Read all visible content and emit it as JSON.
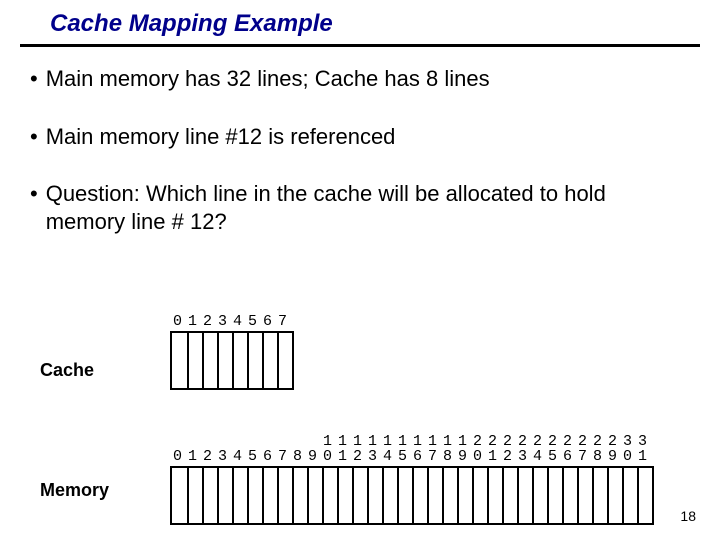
{
  "title": "Cache Mapping Example",
  "bullets": [
    "Main memory has 32 lines; Cache has 8 lines",
    "Main memory line #12 is referenced",
    "Question: Which line in the cache will be allocated to hold memory line # 12?"
  ],
  "cache": {
    "label": "Cache",
    "count": 8,
    "indices": [
      "0",
      "1",
      "2",
      "3",
      "4",
      "5",
      "6",
      "7"
    ]
  },
  "memory": {
    "label": "Memory",
    "count": 32,
    "indices_top": [
      "",
      "",
      "",
      "",
      "",
      "",
      "",
      "",
      "",
      "",
      "1",
      "1",
      "1",
      "1",
      "1",
      "1",
      "1",
      "1",
      "1",
      "1",
      "2",
      "2",
      "2",
      "2",
      "2",
      "2",
      "2",
      "2",
      "2",
      "2",
      "3",
      "3"
    ],
    "indices_bottom": [
      "0",
      "1",
      "2",
      "3",
      "4",
      "5",
      "6",
      "7",
      "8",
      "9",
      "0",
      "1",
      "2",
      "3",
      "4",
      "5",
      "6",
      "7",
      "8",
      "9",
      "0",
      "1",
      "2",
      "3",
      "4",
      "5",
      "6",
      "7",
      "8",
      "9",
      "0",
      "1"
    ]
  },
  "page_number": "18"
}
